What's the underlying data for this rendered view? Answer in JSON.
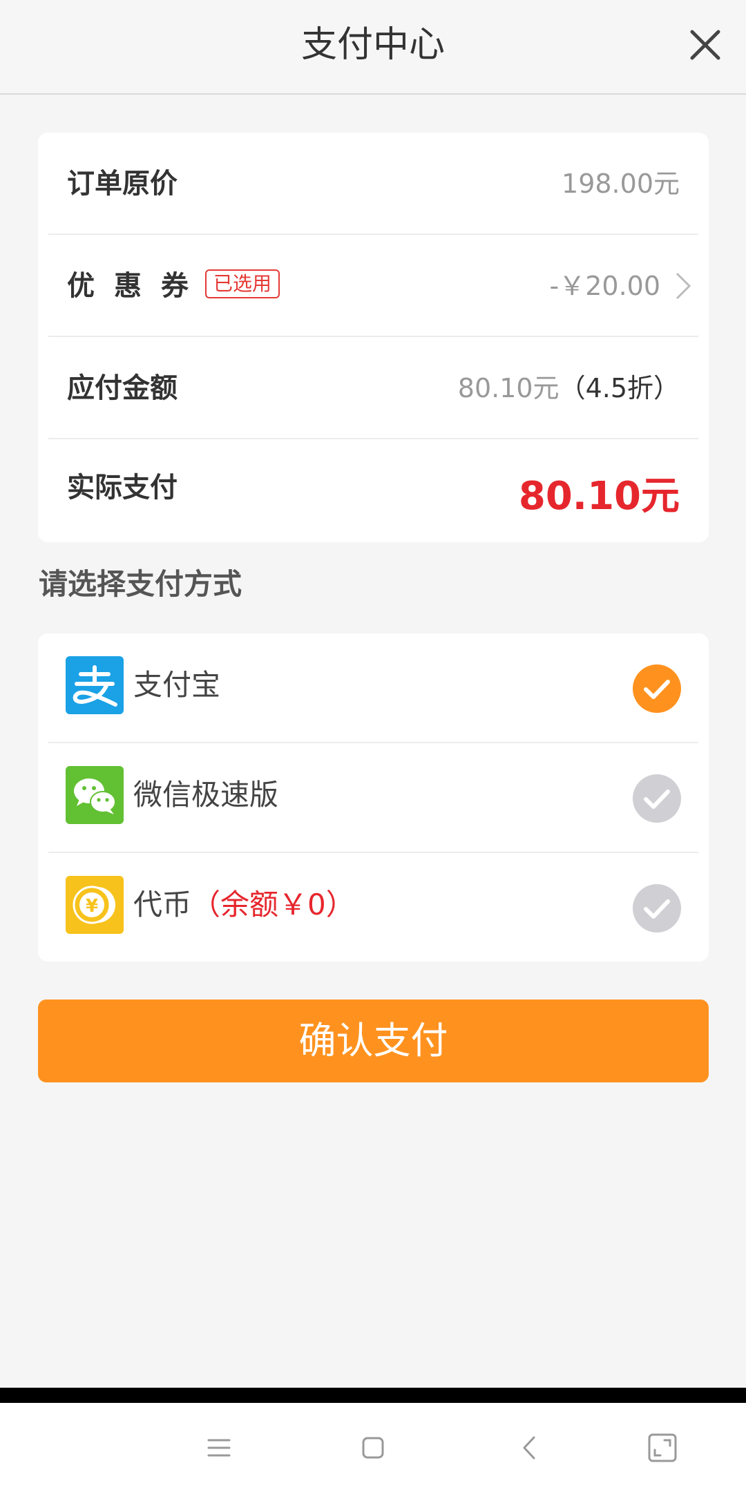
{
  "header": {
    "title": "支付中心"
  },
  "summary": {
    "original_price_label": "订单原价",
    "original_price_value": "198.00元",
    "coupon_label": "优惠券",
    "coupon_badge": "已选用",
    "coupon_value": "-￥20.00",
    "payable_label": "应付金额",
    "payable_value": "80.10元",
    "payable_discount": "（4.5折）",
    "actual_label": "实际支付",
    "actual_value": "80.10元"
  },
  "section": {
    "title": "请选择支付方式"
  },
  "methods": {
    "items": [
      {
        "label": "支付宝",
        "extra": "",
        "selected": true,
        "icon": "alipay-icon"
      },
      {
        "label": "微信极速版",
        "extra": "",
        "selected": false,
        "icon": "wechat-icon"
      },
      {
        "label": "代币",
        "extra": "（余额￥0）",
        "selected": false,
        "icon": "coin-icon"
      }
    ]
  },
  "confirm": {
    "label": "确认支付"
  },
  "nav": {
    "icons": [
      "menu-icon",
      "home-icon",
      "back-icon",
      "fullscreen-icon"
    ]
  },
  "colors": {
    "accent": "#ff921f",
    "price_red": "#e6262d",
    "alipay_blue": "#1aa1e6",
    "wechat_green": "#62c033",
    "coin_yellow": "#f7c21c"
  }
}
